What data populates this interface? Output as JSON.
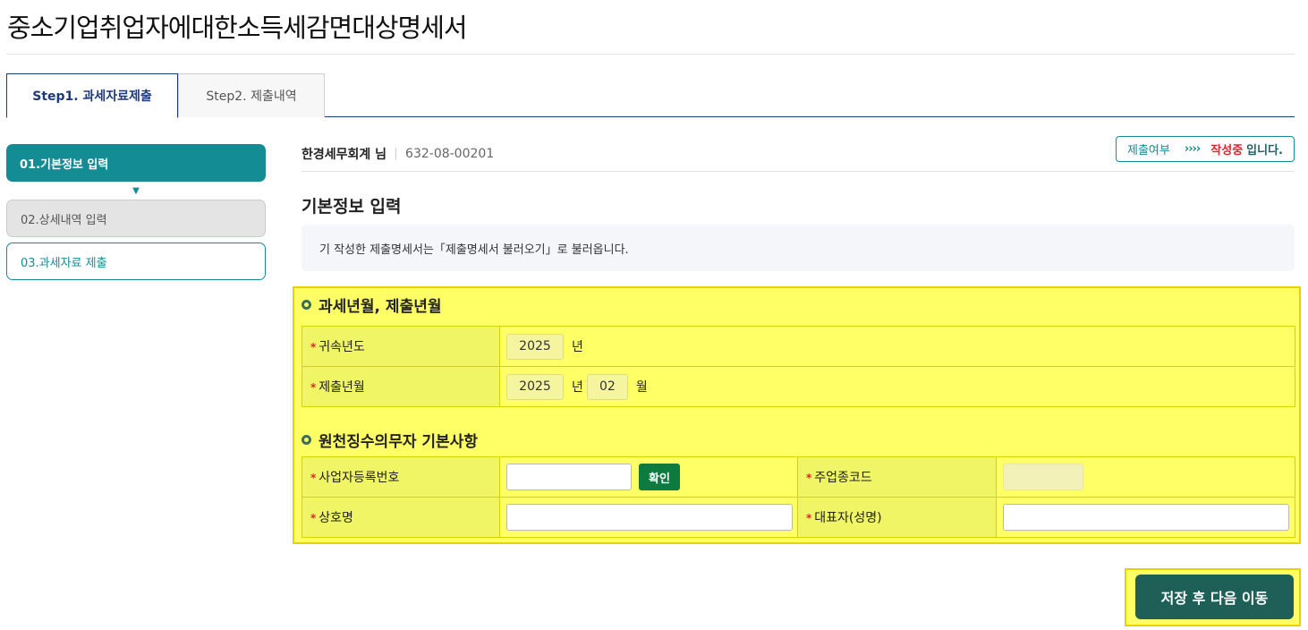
{
  "page": {
    "title": "중소기업취업자에대한소득세감면대상명세서"
  },
  "tabs": [
    {
      "label": "Step1. 과세자료제출",
      "active": true
    },
    {
      "label": "Step2. 제출내역",
      "active": false
    }
  ],
  "steps": [
    {
      "label": "01.기본정보 입력",
      "state": "current"
    },
    {
      "label": "02.상세내역 입력",
      "state": "disabled"
    },
    {
      "label": "03.과세자료 제출",
      "state": "pending"
    }
  ],
  "user": {
    "name": "한경세무회계 님",
    "biz_no": "632-08-00201"
  },
  "status": {
    "label": "제출여부",
    "arrows": "››››",
    "value": "작성중",
    "tail": "입니다."
  },
  "main": {
    "heading": "기본정보 입력",
    "notice": "기 작성한 제출명세서는「제출명세서 불러오기」로 불러옵니다."
  },
  "period_section": {
    "title": "과세년월, 제출년월",
    "rows": {
      "attribution_year": {
        "label": "귀속년도",
        "year": "2025",
        "year_unit": "년"
      },
      "submit_month": {
        "label": "제출년월",
        "year": "2025",
        "year_unit": "년",
        "month": "02",
        "month_unit": "월"
      }
    }
  },
  "withholder_section": {
    "title": "원천징수의무자 기본사항",
    "biz_reg_no": {
      "label": "사업자등록번호",
      "value": "",
      "confirm_label": "확인"
    },
    "industry_code": {
      "label": "주업종코드",
      "value": ""
    },
    "company_name": {
      "label": "상호명",
      "value": ""
    },
    "representative": {
      "label": "대표자(성명)",
      "value": ""
    }
  },
  "required_mark": "*",
  "actions": {
    "save_next": "저장 후 다음 이동"
  },
  "colors": {
    "teal": "#138c93",
    "navy": "#1e3a78",
    "highlight": "#ffff66",
    "required": "#d9262c",
    "confirm": "#0d7a3e",
    "save": "#1e5f57"
  }
}
